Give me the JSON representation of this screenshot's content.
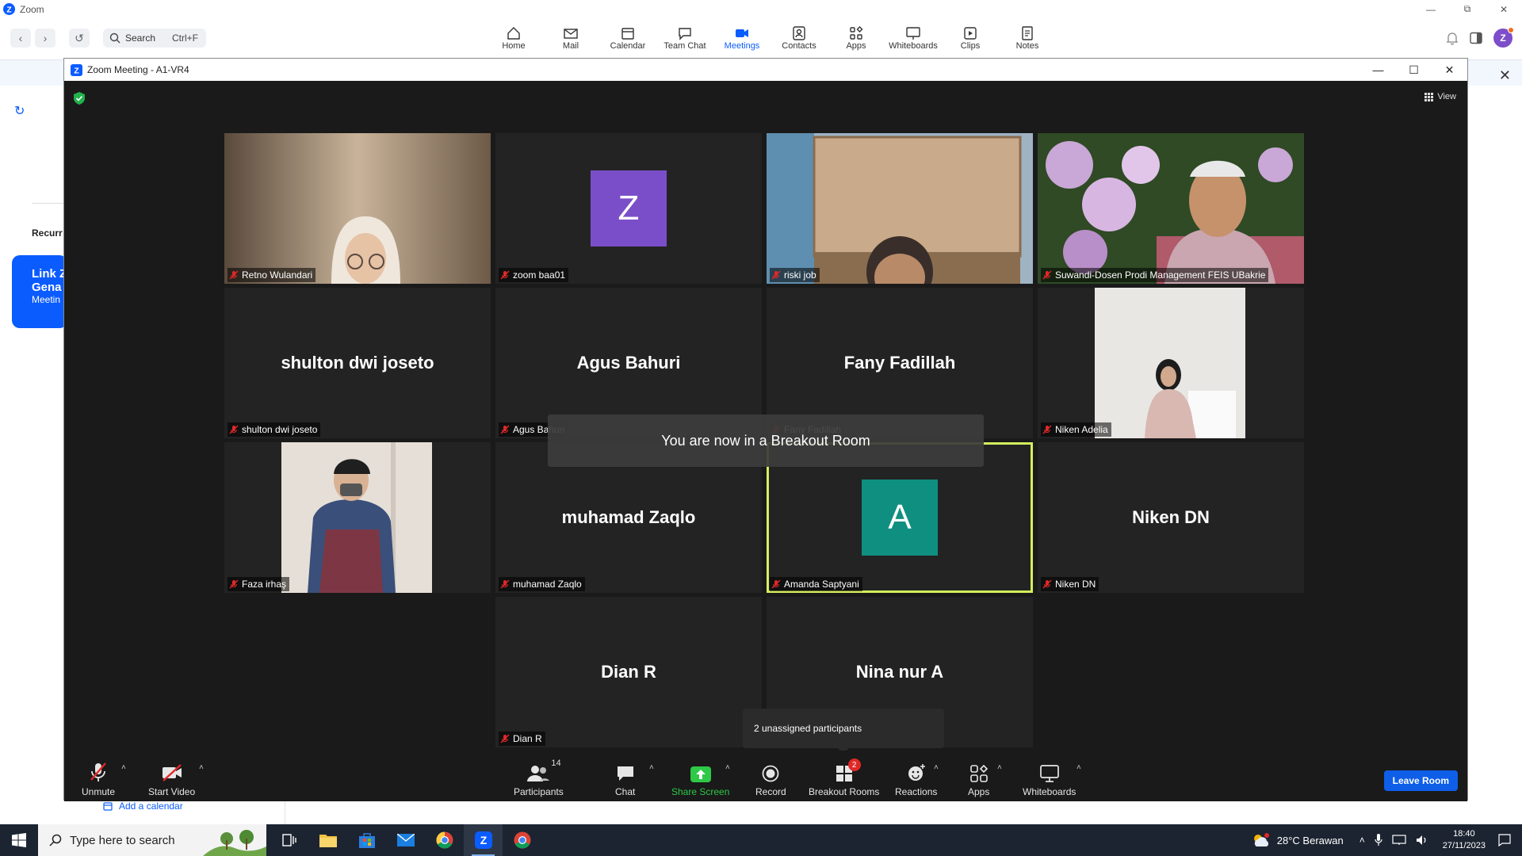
{
  "app": {
    "title": "Zoom",
    "search_label": "Search",
    "search_shortcut": "Ctrl+F",
    "nav": [
      {
        "label": "Home",
        "icon": "home-icon"
      },
      {
        "label": "Mail",
        "icon": "mail-icon"
      },
      {
        "label": "Calendar",
        "icon": "calendar-icon"
      },
      {
        "label": "Team Chat",
        "icon": "chat-icon"
      },
      {
        "label": "Meetings",
        "icon": "video-icon",
        "active": true
      },
      {
        "label": "Contacts",
        "icon": "contacts-icon"
      },
      {
        "label": "Apps",
        "icon": "apps-icon"
      },
      {
        "label": "Whiteboards",
        "icon": "whiteboard-icon"
      },
      {
        "label": "Clips",
        "icon": "clips-icon"
      },
      {
        "label": "Notes",
        "icon": "notes-icon"
      }
    ],
    "avatar_initial": "Z",
    "recurring_label": "Recurr",
    "card": {
      "line1": "Link Z",
      "line2": "Gena",
      "line3": "Meetin"
    },
    "add_calendar": "Add a calendar"
  },
  "meeting": {
    "title": "Zoom Meeting - A1-VR4",
    "view_label": "View",
    "toast": "You are now in a Breakout Room",
    "unassigned": "2 unassigned participants",
    "tiles": [
      {
        "name": "Retno Wulandari",
        "type": "video"
      },
      {
        "name": "zoom baa01",
        "type": "avatar",
        "initial": "Z",
        "color": "#7b4ec9"
      },
      {
        "name": "riski job",
        "type": "video"
      },
      {
        "name": "Suwandi-Dosen Prodi Management FEIS UBakrie",
        "type": "video"
      },
      {
        "name": "shulton dwi joseto",
        "type": "name"
      },
      {
        "name": "Agus Bahuri",
        "type": "name"
      },
      {
        "name": "Fany Fadillah",
        "type": "name"
      },
      {
        "name": "Niken Adelia",
        "type": "video"
      },
      {
        "name": "Faza irhaş",
        "type": "video"
      },
      {
        "name": "muhamad Zaqlo",
        "type": "name"
      },
      {
        "name": "Amanda Saptyani",
        "type": "avatar",
        "initial": "A",
        "color": "#0f8f80",
        "speaking": true
      },
      {
        "name": "Niken DN",
        "type": "name"
      },
      {
        "name": "Dian R",
        "type": "name"
      },
      {
        "name": "Nina nur A",
        "type": "name"
      }
    ],
    "toolbar": {
      "unmute": "Unmute",
      "start_video": "Start Video",
      "participants": "Participants",
      "participants_count": "14",
      "chat": "Chat",
      "share_screen": "Share Screen",
      "record": "Record",
      "breakout_rooms": "Breakout Rooms",
      "breakout_badge": "2",
      "reactions": "Reactions",
      "apps": "Apps",
      "whiteboards": "Whiteboards",
      "leave_room": "Leave Room"
    }
  },
  "taskbar": {
    "search_placeholder": "Type here to search",
    "weather": "28°C  Berawan",
    "time": "18:40",
    "date": "27/11/2023"
  },
  "colors": {
    "zoom_blue": "#0b5cff",
    "meeting_bg": "#1a1a1a",
    "tile_bg": "#232323",
    "speaking_border": "#d4ef5d",
    "share_green": "#2ec947",
    "taskbar_bg": "#1c2431"
  }
}
